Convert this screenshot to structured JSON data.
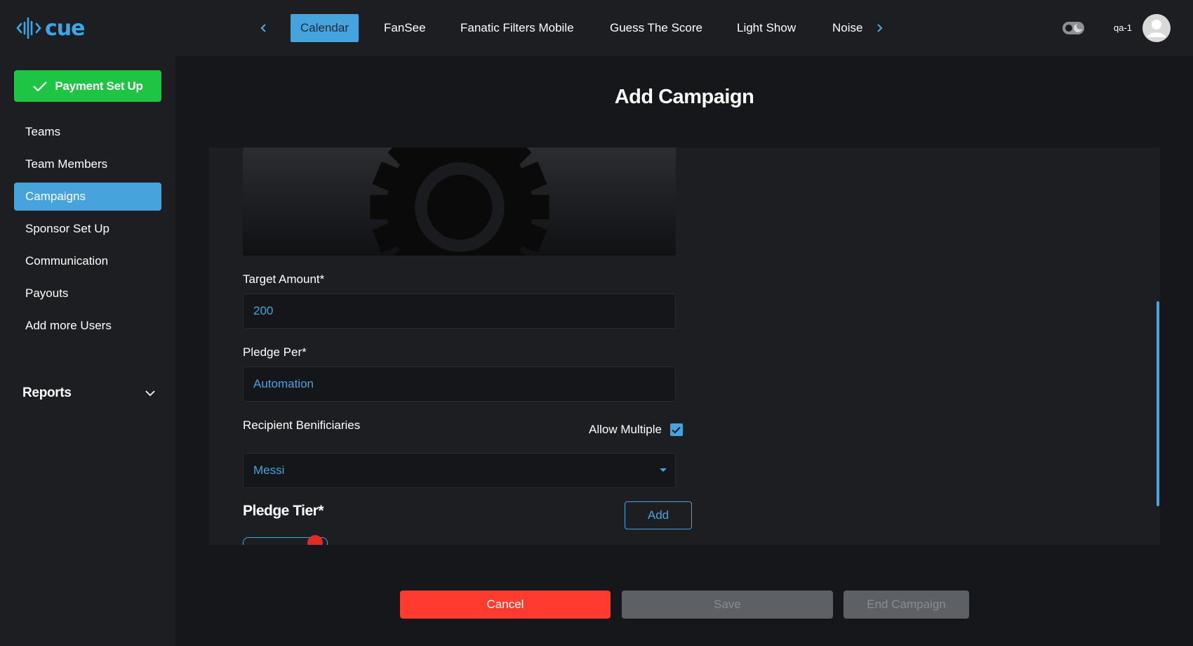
{
  "app": {
    "logo_text": "cue",
    "brand_color": "#3ba6e8"
  },
  "topnav": {
    "tabs": [
      {
        "label": "Calendar",
        "active": true
      },
      {
        "label": "FanSee"
      },
      {
        "label": "Fanatic Filters Mobile"
      },
      {
        "label": "Guess The Score"
      },
      {
        "label": "Light Show"
      },
      {
        "label": "Noise"
      }
    ],
    "prev_icon": "chevron-left-icon",
    "next_icon": "chevron-right-icon"
  },
  "header": {
    "user_name": "qa-1",
    "theme_icon": "theme-toggle-icon",
    "avatar_icon": "user-avatar-icon"
  },
  "sidebar": {
    "payment_button": "Payment Set Up",
    "items": [
      {
        "label": "Teams"
      },
      {
        "label": "Team Members"
      },
      {
        "label": "Campaigns",
        "active": true
      },
      {
        "label": "Sponsor Set Up"
      },
      {
        "label": "Communication"
      },
      {
        "label": "Payouts"
      },
      {
        "label": "Add more Users"
      }
    ],
    "reports_label": "Reports"
  },
  "main": {
    "title": "Add Campaign",
    "form": {
      "image_icon": "gear-icon",
      "target_amount_label": "Target Amount*",
      "target_amount_value": "200",
      "pledge_per_label": "Pledge Per*",
      "pledge_per_value": "Automation",
      "recipient_label": "Recipient Benificiaries",
      "allow_multiple_label": "Allow Multiple",
      "allow_multiple_checked": true,
      "recipient_value": "Messi",
      "pledge_tier_label": "Pledge Tier*",
      "add_button": "Add"
    },
    "actions": {
      "cancel": "Cancel",
      "save": "Save",
      "end": "End Campaign"
    }
  },
  "colors": {
    "accent": "#47a3dc",
    "success": "#1ec443",
    "danger": "#ff3b30",
    "disabled": "#5d6065"
  }
}
